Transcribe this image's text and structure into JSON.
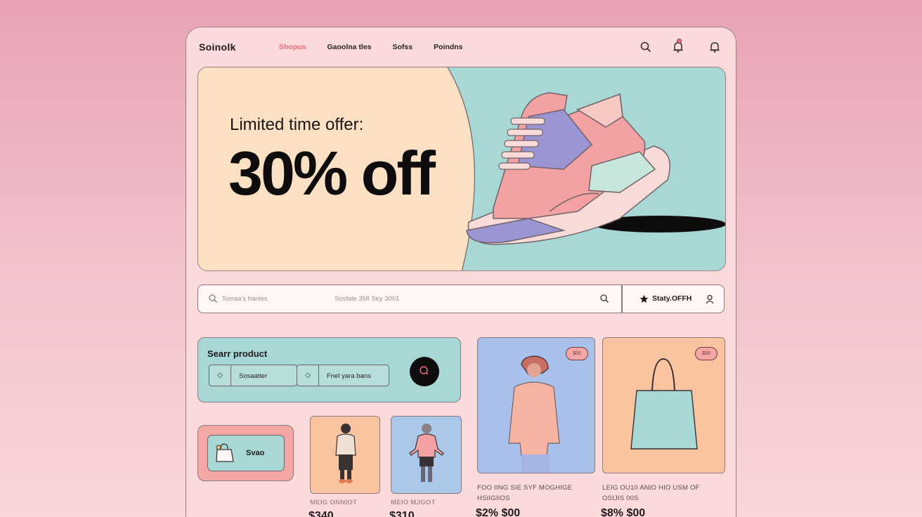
{
  "header": {
    "brand": "Soinolk",
    "nav": [
      "Shopus",
      "Gaoolna tles",
      "Sofss",
      "Poindns"
    ]
  },
  "hero": {
    "subtitle": "Limited time offer:",
    "headline": "30% off"
  },
  "search": {
    "placeholder": "Sonaa's hanles",
    "middle_text": "Sosfale 35fl  Sey 3001",
    "offer_label": "Staty.OFFH"
  },
  "search_product": {
    "title": "Searr product",
    "field1": "Sosaatier",
    "field2": "Fnel yara bans"
  },
  "shop": {
    "label": "Svao"
  },
  "products": [
    {
      "name": "MEIG ONNIOT",
      "price": "$340"
    },
    {
      "name": "MEIO MJGOT",
      "price": "$310"
    },
    {
      "name": "FOO IING SIE SYF MOGHIGE",
      "name2": "HSIIGIIOS",
      "price": "$2% $00",
      "badge": "$00"
    },
    {
      "name": "LEIG OU10 ANIO HIO USM OF",
      "name2": "OSIJIS 00S",
      "price": "$8% $00",
      "badge": "$00"
    }
  ],
  "colors": {
    "accent": "#ef6f7e",
    "mint": "#a8d8d6",
    "peach": "#fbe0c4",
    "pink": "#f4a7a4",
    "frame": "#fbdadb"
  }
}
